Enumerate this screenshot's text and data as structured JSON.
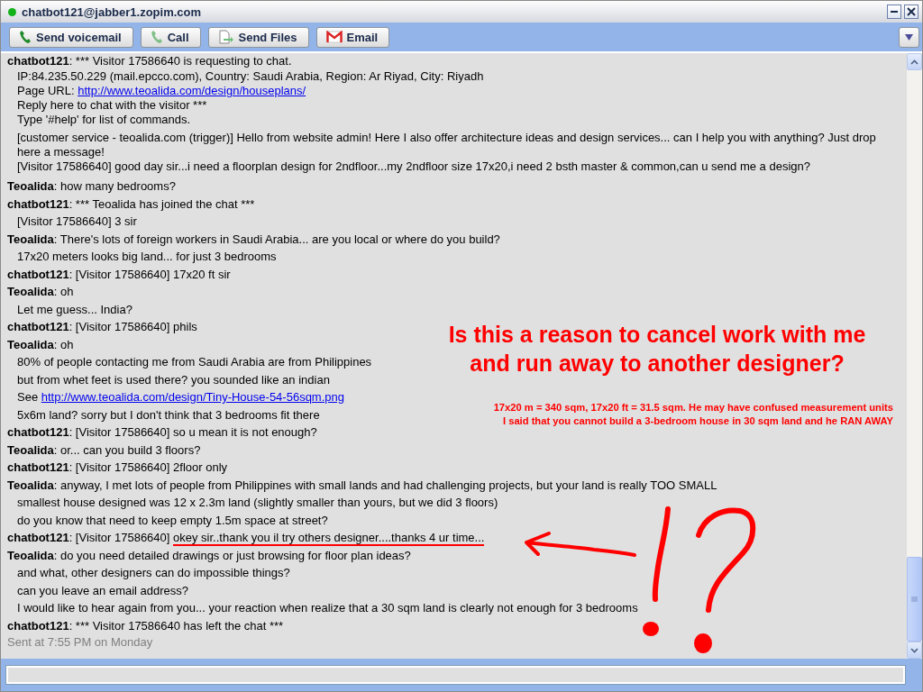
{
  "window": {
    "title": "chatbot121@jabber1.zopim.com",
    "online": true
  },
  "toolbar": {
    "buttons": [
      {
        "label": "Send voicemail",
        "kind": "phone"
      },
      {
        "label": "Call",
        "kind": "phone-faded"
      },
      {
        "label": "Send Files",
        "kind": "file"
      },
      {
        "label": "Email",
        "kind": "mail"
      }
    ]
  },
  "messages": [
    {
      "sender": "chatbot121",
      "text": ": *** Visitor 17586640 is requesting to chat.",
      "lines": [
        {
          "text": "IP:84.235.50.229 (mail.epcco.com), Country: Saudi Arabia, Region: Ar Riyad, City: Riyadh"
        },
        {
          "text": "Page URL: ",
          "link": "http://www.teoalida.com/design/houseplans/"
        },
        {
          "text": "Reply here to chat with the visitor ***"
        },
        {
          "text": "Type '#help' for list of commands."
        }
      ]
    },
    {
      "lines": [
        {
          "text": "[customer service - teoalida.com (trigger)] Hello from website admin! Here I also offer architecture ideas and design services... can I help you with anything? Just drop here a message!"
        },
        {
          "text": "[Visitor 17586640] good day sir...i need a floorplan design for 2ndfloor...my 2ndfloor size 17x20,i need 2 bsth master & common,can u send me a design?"
        }
      ]
    },
    {
      "sender": "Teoalida",
      "text": ": how many bedrooms?"
    },
    {
      "sender": "chatbot121",
      "text": ": *** Teoalida has joined the chat ***",
      "lines": [
        {
          "text": "[Visitor 17586640] 3 sir"
        }
      ]
    },
    {
      "sender": "Teoalida",
      "text": ": There's lots of foreign workers in Saudi Arabia... are you local or where do you build?",
      "lines": [
        {
          "text": "17x20 meters looks big land... for just 3 bedrooms"
        }
      ]
    },
    {
      "sender": "chatbot121",
      "text": ": [Visitor 17586640] 17x20 ft sir"
    },
    {
      "sender": "Teoalida",
      "text": ": oh",
      "lines": [
        {
          "text": "Let me guess... India?"
        }
      ]
    },
    {
      "sender": "chatbot121",
      "text": ": [Visitor 17586640] phils"
    },
    {
      "sender": "Teoalida",
      "text": ": oh",
      "lines": [
        {
          "text": "80% of people contacting me from Saudi Arabia are from Philippines"
        },
        {
          "text": "but from whet feet is used there? you sounded like an indian"
        },
        {
          "text": "See ",
          "link": "http://www.teoalida.com/design/Tiny-House-54-56sqm.png"
        },
        {
          "text": "5x6m land? sorry but I don't think that 3 bedrooms fit there"
        }
      ]
    },
    {
      "sender": "chatbot121",
      "text": ": [Visitor 17586640] so u mean it is not enough?"
    },
    {
      "sender": "Teoalida",
      "text": ": or... can you build 3 floors?"
    },
    {
      "sender": "chatbot121",
      "text": ": [Visitor 17586640] 2floor only"
    },
    {
      "sender": "Teoalida",
      "text": ": anyway, I met lots of people from Philippines with small lands and had challenging projects, but your land is really TOO SMALL",
      "lines": [
        {
          "text": "smallest house designed was 12 x 2.3m land (slightly smaller than yours, but we did 3 floors)"
        },
        {
          "text": "do you know that need to keep empty 1.5m space at street?"
        }
      ]
    },
    {
      "sender": "chatbot121",
      "text": ": [Visitor 17586640] ",
      "underlined": "okey sir..thank you il try others designer....thanks 4 ur time..."
    },
    {
      "sender": "Teoalida",
      "text": ": do you need detailed drawings or just browsing for floor plan ideas?",
      "lines": [
        {
          "text": "and what, other designers can do impossible things?"
        },
        {
          "text": "can you leave an email address?"
        },
        {
          "text": "I would like to hear again from you... your reaction when realize that a 30 sqm land is clearly not enough for 3 bedrooms"
        }
      ]
    },
    {
      "sender": "chatbot121",
      "text": ": *** Visitor 17586640 has left the chat ***"
    }
  ],
  "sent_note": "Sent at 7:55 PM on Monday",
  "annotation": {
    "headline": [
      "Is this a reason to cancel work with me",
      "and run away to another designer?"
    ],
    "note": [
      "17x20 m = 340 sqm, 17x20 ft = 31.5 sqm. He may have confused measurement units",
      "I said that you cannot build a 3-bedroom house in 30 sqm land and he RAN AWAY"
    ]
  }
}
